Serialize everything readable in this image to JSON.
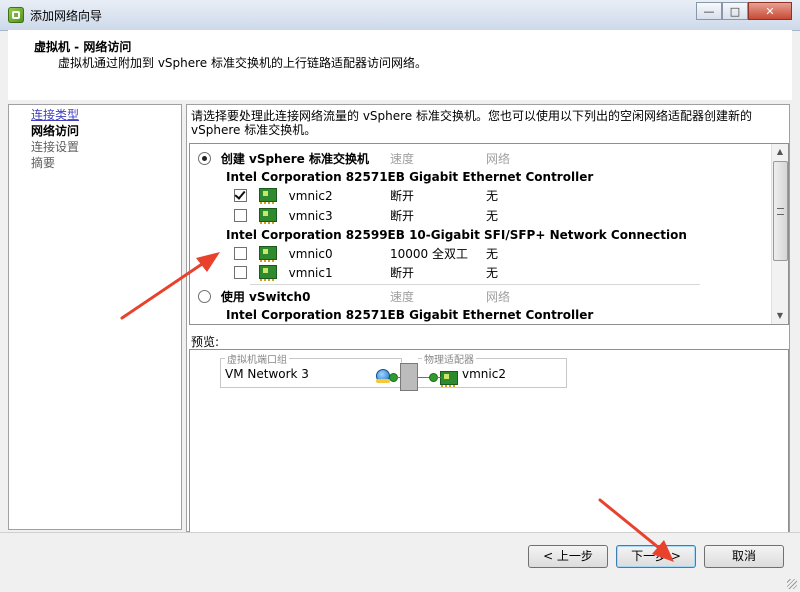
{
  "window": {
    "title": "添加网络向导",
    "minimize_glyph": "—",
    "maximize_glyph": "□",
    "close_glyph": "✕"
  },
  "header": {
    "title": "虚拟机 - 网络访问",
    "subtitle": "虚拟机通过附加到 vSphere 标准交换机的上行链路适配器访问网络。"
  },
  "steps": [
    {
      "label": "连接类型",
      "state": "link"
    },
    {
      "label": "网络访问",
      "state": "current"
    },
    {
      "label": "连接设置",
      "state": "pending"
    },
    {
      "label": "摘要",
      "state": "pending"
    }
  ],
  "instructions": "请选择要处理此连接网络流量的 vSphere 标准交换机。您也可以使用以下列出的空闲网络适配器创建新的 vSphere 标准交换机。",
  "switch_list": {
    "create_option": {
      "label": "创建 vSphere 标准交换机",
      "selected": true
    },
    "speed_header": "速度",
    "network_header": "网络",
    "groups": [
      {
        "controller": "Intel Corporation 82571EB Gigabit Ethernet Controller",
        "nics": [
          {
            "name": "vmnic2",
            "checked": true,
            "speed": "断开",
            "network": "无"
          },
          {
            "name": "vmnic3",
            "checked": false,
            "speed": "断开",
            "network": "无"
          }
        ]
      },
      {
        "controller": "Intel Corporation 82599EB 10-Gigabit SFI/SFP+ Network Connection",
        "nics": [
          {
            "name": "vmnic0",
            "checked": false,
            "speed": "10000 全双工",
            "network": "无"
          },
          {
            "name": "vmnic1",
            "checked": false,
            "speed": "断开",
            "network": "无"
          }
        ]
      }
    ],
    "existing_option": {
      "label": "使用 vSwitch0",
      "selected": false,
      "speed": "速度",
      "network": "网络"
    },
    "existing_controller": "Intel Corporation 82571EB Gigabit Ethernet Controller"
  },
  "preview": {
    "label": "预览:",
    "portgroup_legend": "虚拟机端口组",
    "portgroup_name": "VM Network 3",
    "adapter_legend": "物理适配器",
    "adapter_name": "vmnic2"
  },
  "buttons": {
    "back": "< 上一步",
    "next": "下一步 >",
    "cancel": "取消"
  },
  "colors": {
    "annotation_arrow": "#e8412c",
    "link": "#4040c0"
  },
  "icons": {
    "nic": "network-adapter-icon",
    "portgroup": "globe-icon",
    "app": "vsphere-client-icon"
  }
}
